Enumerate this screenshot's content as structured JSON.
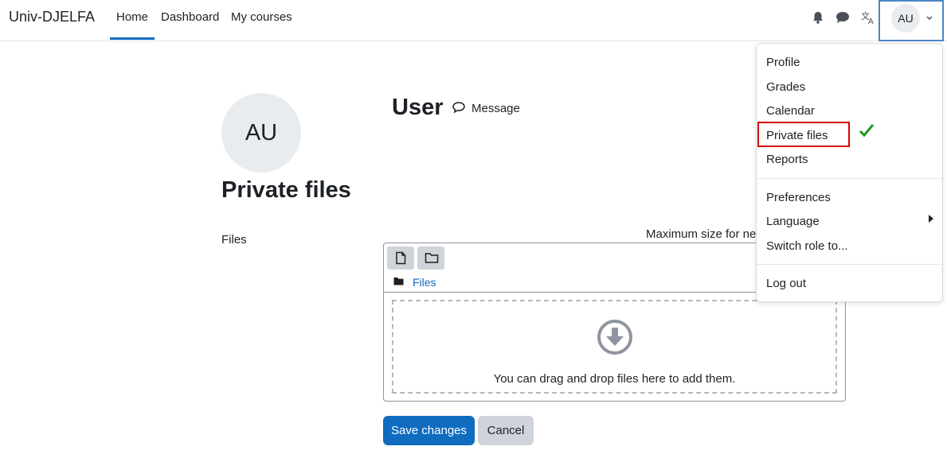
{
  "navbar": {
    "brand": "Univ-DJELFA",
    "links": [
      "Home",
      "Dashboard",
      "My courses"
    ],
    "active_link": "Home",
    "user_initials": "AU"
  },
  "profile": {
    "initials": "AU",
    "name": "User",
    "message_label": "Message"
  },
  "page_title": "Private files",
  "form": {
    "files_label": "Files",
    "max_size_text": "Maximum size for ne",
    "filepicker_path": "Files",
    "drop_text": "You can drag and drop files here to add them.",
    "save_label": "Save changes",
    "cancel_label": "Cancel"
  },
  "user_menu": {
    "items": [
      "Profile",
      "Grades",
      "Calendar",
      "Private files",
      "Reports"
    ],
    "items2": [
      "Preferences",
      "Language",
      "Switch role to..."
    ],
    "logout": "Log out",
    "highlighted_item": "Private files"
  },
  "colors": {
    "primary": "#0f6cbf",
    "highlight_border": "#d40000",
    "check": "#1a9a1a",
    "user_box_border": "#4a86c5"
  }
}
